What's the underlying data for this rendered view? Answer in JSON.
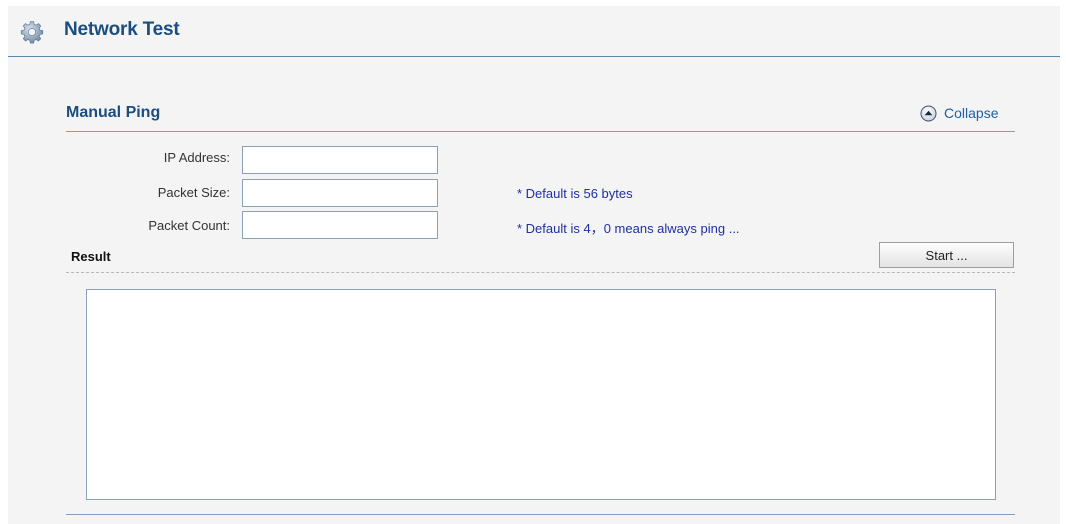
{
  "header": {
    "title": "Network Test",
    "icon": "gear-icon"
  },
  "section": {
    "title": "Manual Ping",
    "collapse_label": "Collapse",
    "collapse_icon": "circle-arrow-up-icon"
  },
  "form": {
    "ip_address": {
      "label": "IP Address:",
      "value": ""
    },
    "packet_size": {
      "label": "Packet Size:",
      "value": "",
      "hint": "* Default is 56 bytes"
    },
    "packet_count": {
      "label": "Packet Count:",
      "value": "",
      "hint": "* Default is 4，0 means always ping ..."
    }
  },
  "result": {
    "label": "Result",
    "start_label": "Start ...",
    "output": ""
  },
  "colors": {
    "title_blue": "#1b4e7e",
    "hint_blue": "#1f2fa5",
    "rule_blue": "#7f9fc0",
    "panel_bg": "#f4f4f4"
  }
}
